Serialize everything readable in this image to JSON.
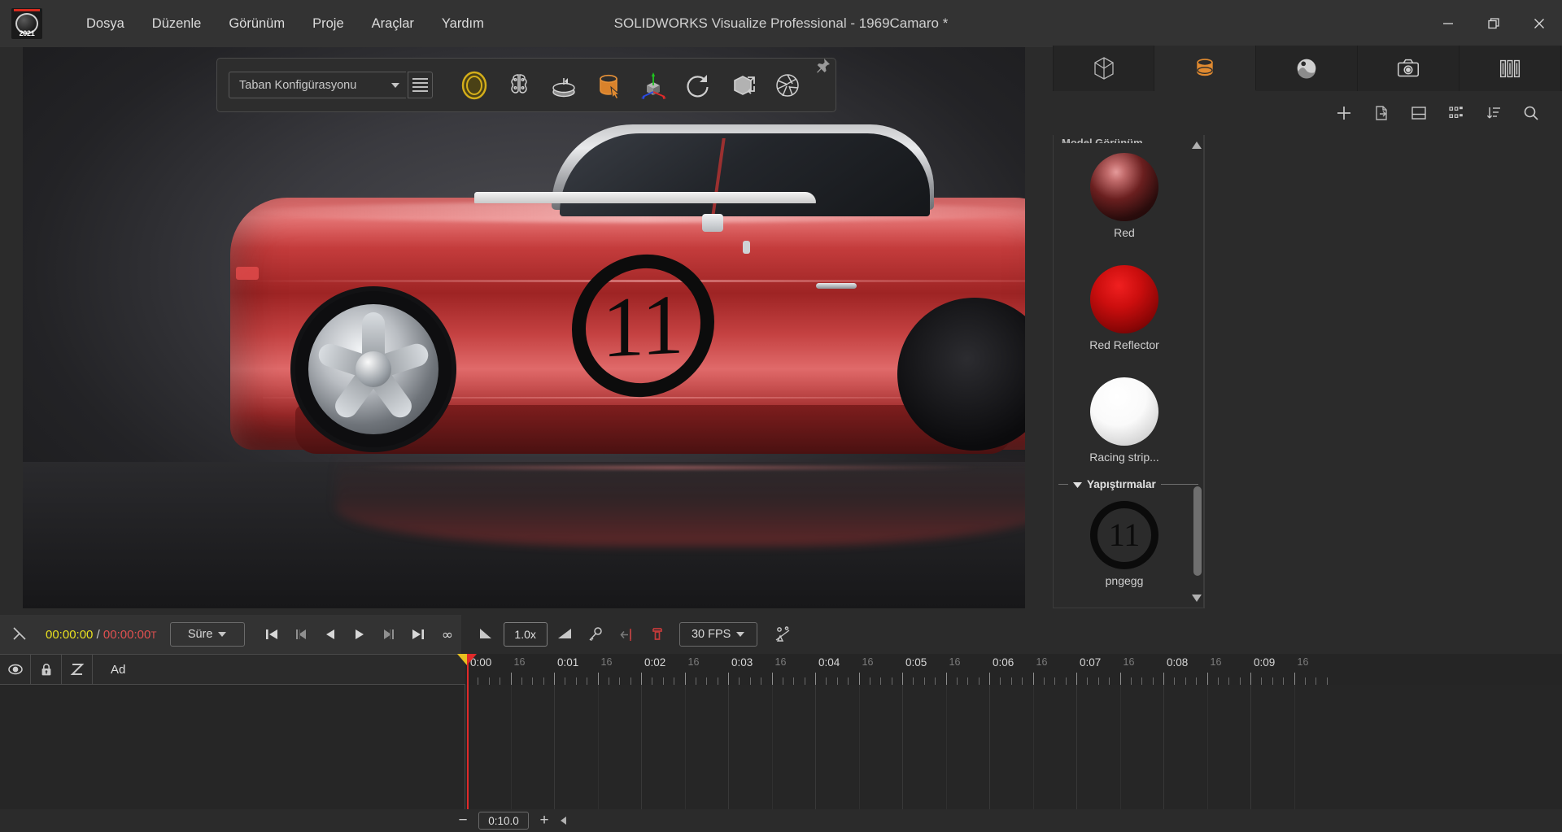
{
  "window": {
    "title": "SOLIDWORKS Visualize Professional - 1969Camaro *",
    "logo_year": "2021",
    "controls": {
      "minimize": "minimize-icon",
      "restore": "restore-icon",
      "close": "close-icon"
    }
  },
  "menu": {
    "items": [
      {
        "label": "Dosya"
      },
      {
        "label": "Düzenle"
      },
      {
        "label": "Görünüm"
      },
      {
        "label": "Proje"
      },
      {
        "label": "Araçlar"
      },
      {
        "label": "Yardım"
      }
    ]
  },
  "viewport_toolbar": {
    "configuration": {
      "value": "Taban Konfigürasyonu",
      "list_icon": "list-icon",
      "dropdown_icon": "chevron-down-icon"
    },
    "pin_icon": "pin-icon",
    "tools": [
      {
        "name": "ring-tool-icon",
        "label": "Render Modu",
        "color": "#c7a41c"
      },
      {
        "name": "brain-tool-icon",
        "label": "Denoiser",
        "color": "#cfcfcf"
      },
      {
        "name": "pedestal-tool-icon",
        "label": "Zemin",
        "color": "#cfcfcf"
      },
      {
        "name": "paint-bucket-tool-icon",
        "label": "Görünüm",
        "color": "#e08a30"
      },
      {
        "name": "axis-cube-tool-icon",
        "label": "Manipülatör",
        "color": "#b0b0b0"
      },
      {
        "name": "refresh-tool-icon",
        "label": "Yenile",
        "color": "#cfcfcf"
      },
      {
        "name": "import-cube-tool-icon",
        "label": "İçe Aktar",
        "color": "#cfcfcf"
      },
      {
        "name": "aperture-tool-icon",
        "label": "Kamera",
        "color": "#cfcfcf"
      }
    ]
  },
  "viewport": {
    "decal_number": "11"
  },
  "right_panel": {
    "tabs": [
      {
        "name": "tab-models",
        "icon": "cube-icon",
        "active": false
      },
      {
        "name": "tab-appearances",
        "icon": "paint-bucket-icon",
        "active": true
      },
      {
        "name": "tab-environments",
        "icon": "image-icon",
        "active": false
      },
      {
        "name": "tab-cameras",
        "icon": "camera-icon",
        "active": false
      },
      {
        "name": "tab-filters",
        "icon": "filmstrip-icon",
        "active": false
      }
    ],
    "actions": [
      {
        "name": "add-button",
        "icon": "plus-icon"
      },
      {
        "name": "export-button",
        "icon": "file-export-icon"
      },
      {
        "name": "split-view-button",
        "icon": "split-view-icon"
      },
      {
        "name": "grid-view-button",
        "icon": "grid-view-icon"
      },
      {
        "name": "sort-button",
        "icon": "sort-icon"
      },
      {
        "name": "search-button",
        "icon": "search-icon"
      }
    ],
    "group_clipped_label": "Model Görünüm",
    "appearances": [
      {
        "label": "Red",
        "swatch": "dark-red-glossy"
      },
      {
        "label": "Red Reflector",
        "swatch": "bright-red"
      },
      {
        "label": "Racing strip...",
        "swatch": "white"
      }
    ],
    "decals_section": {
      "label": "Yapıştırmalar",
      "collapse_icon": "chevron-down-icon"
    },
    "decals": [
      {
        "label": "pngegg",
        "number": "11"
      }
    ],
    "scroll_up_icon": "chevron-up-icon",
    "scroll_down_icon": "chevron-down-icon"
  },
  "timeline_toolbar": {
    "keyframe_tool_icon": "keyframe-tool-icon",
    "timecode": {
      "current": "00:00:00",
      "separator": "/",
      "total": "00:00:00",
      "suffix": "T"
    },
    "duration_select": {
      "label": "Süre",
      "icon": "chevron-down-icon"
    },
    "transport": [
      {
        "name": "go-to-start-button",
        "icon": "skip-start-icon"
      },
      {
        "name": "step-back-button",
        "icon": "step-back-icon"
      },
      {
        "name": "play-reverse-button",
        "icon": "play-reverse-icon"
      },
      {
        "name": "play-button",
        "icon": "play-icon"
      },
      {
        "name": "step-forward-button",
        "icon": "step-forward-icon"
      },
      {
        "name": "go-to-end-button",
        "icon": "skip-end-icon"
      },
      {
        "name": "loop-button",
        "icon": "infinity-icon"
      }
    ],
    "right_tools": [
      {
        "name": "ease-in-button",
        "icon": "ease-in-icon"
      },
      {
        "name": "speed-field",
        "value": "1.0x"
      },
      {
        "name": "ease-out-button",
        "icon": "ease-out-icon"
      },
      {
        "name": "add-keyframe-button",
        "icon": "key-icon"
      },
      {
        "name": "previous-keyframe-button",
        "icon": "prev-keyframe-icon"
      },
      {
        "name": "delete-keyframe-button",
        "icon": "delete-keyframe-icon"
      },
      {
        "name": "fps-select",
        "value": "30 FPS",
        "icon": "chevron-down-icon"
      },
      {
        "name": "interpolation-button",
        "icon": "interpolation-icon"
      }
    ]
  },
  "timeline": {
    "header": {
      "visibility_icon": "eye-icon",
      "lock_icon": "lock-icon",
      "curve_icon": "z-curve-icon",
      "name_column": "Ad"
    },
    "ruler": {
      "seconds": [
        "0:00",
        "0:01",
        "0:02",
        "0:03",
        "0:04",
        "0:05",
        "0:06",
        "0:07",
        "0:08",
        "0:09"
      ],
      "sub_label": "16",
      "playhead_position": "0:00"
    },
    "zoom": {
      "minus": "−",
      "value": "0:10.0",
      "plus": "+",
      "collapse_icon": "chevron-left-icon"
    }
  },
  "colors": {
    "accent_orange": "#e08a30",
    "accent_yellow": "#e8e020",
    "accent_red": "#e05050",
    "panel_bg": "#2b2b2b",
    "titlebar_bg": "#333333"
  }
}
